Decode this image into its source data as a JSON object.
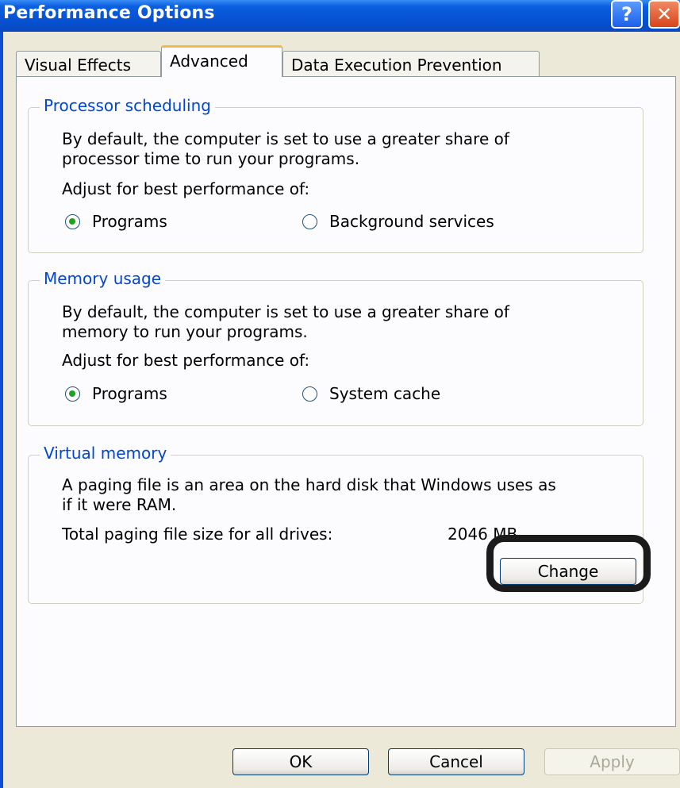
{
  "window": {
    "title": "Performance Options",
    "help_glyph": "?",
    "close_glyph": "✕"
  },
  "tabs": [
    "Visual Effects",
    "Advanced",
    "Data Execution Prevention"
  ],
  "processor": {
    "title": "Processor scheduling",
    "desc_line1": "By default, the computer is set to use a greater share of",
    "desc_line2": "processor time to run your programs.",
    "adjust": "Adjust for best performance of:",
    "opt1": "Programs",
    "opt2": "Background services",
    "selected": "Programs"
  },
  "memory": {
    "title": "Memory usage",
    "desc_line1": "By default, the computer is set to use a greater share of",
    "desc_line2": "memory to run your programs.",
    "adjust": "Adjust for best performance of:",
    "opt1": "Programs",
    "opt2": "System cache",
    "selected": "Programs"
  },
  "virtual": {
    "title": "Virtual memory",
    "desc_line1": "A paging file is an area on the hard disk that Windows uses as",
    "desc_line2": "if it were RAM.",
    "total_label": "Total paging file size for all drives:",
    "total_value": "2046 MB",
    "change_label": "Change"
  },
  "buttons": {
    "ok": "OK",
    "cancel": "Cancel",
    "apply": "Apply"
  },
  "colors": {
    "titlebar": "#0550d0",
    "group_title": "#0046d5",
    "highlight": "#1b1b1b"
  }
}
